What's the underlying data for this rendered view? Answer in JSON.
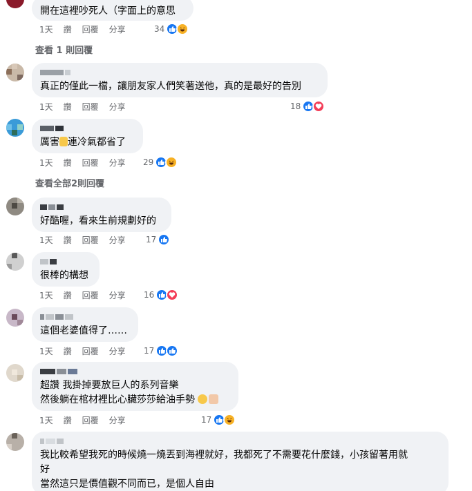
{
  "comments": [
    {
      "text": "開在這裡吵死人（字面上的意思",
      "time": "1天",
      "like_label": "讚",
      "reply_label": "回覆",
      "share_label": "分享",
      "reactions": "34",
      "view_replies": "查看 1 則回覆"
    },
    {
      "text": "真正的僅此一檔，讓朋友家人們笑著送他，真的是最好的告別",
      "time": "1天",
      "like_label": "讚",
      "reply_label": "回覆",
      "share_label": "分享",
      "reactions": "18"
    },
    {
      "text_a": "厲害",
      "text_b": "連冷氣都省了",
      "time": "1天",
      "like_label": "讚",
      "reply_label": "回覆",
      "share_label": "分享",
      "reactions": "29",
      "view_replies": "查看全部2則回覆"
    },
    {
      "text": "好酷喔，看來生前規劃好的",
      "time": "1天",
      "like_label": "讚",
      "reply_label": "回覆",
      "share_label": "分享",
      "reactions": "17"
    },
    {
      "text": "很棒的構想",
      "time": "1天",
      "like_label": "讚",
      "reply_label": "回覆",
      "share_label": "分享",
      "reactions": "16"
    },
    {
      "text": "這個老婆值得了……",
      "time": "1天",
      "like_label": "讚",
      "reply_label": "回覆",
      "share_label": "分享",
      "reactions": "17"
    },
    {
      "line1": "超讚 我掛掉要放巨人的系列音樂",
      "line2": "然後躺在棺材裡比心臟莎莎給油手勢",
      "time": "1天",
      "like_label": "讚",
      "reply_label": "回覆",
      "share_label": "分享",
      "reactions": "17"
    },
    {
      "line1": "我比較希望我死的時候燒一燒丟到海裡就好，我都死了不需要花什麼錢，小孩留著用就",
      "line2": "好",
      "line3": "當然這只是價值觀不同而已，是個人自由"
    }
  ],
  "colors": {
    "bubble": "#f0f2f5",
    "like": "#1877f2",
    "love": "#f33e58",
    "haha": "#f7b125",
    "meta": "#65676b"
  },
  "icons": [
    "like-icon",
    "love-icon",
    "haha-icon",
    "thumbs-up-emoji",
    "grin-emoji",
    "flex-emoji"
  ]
}
